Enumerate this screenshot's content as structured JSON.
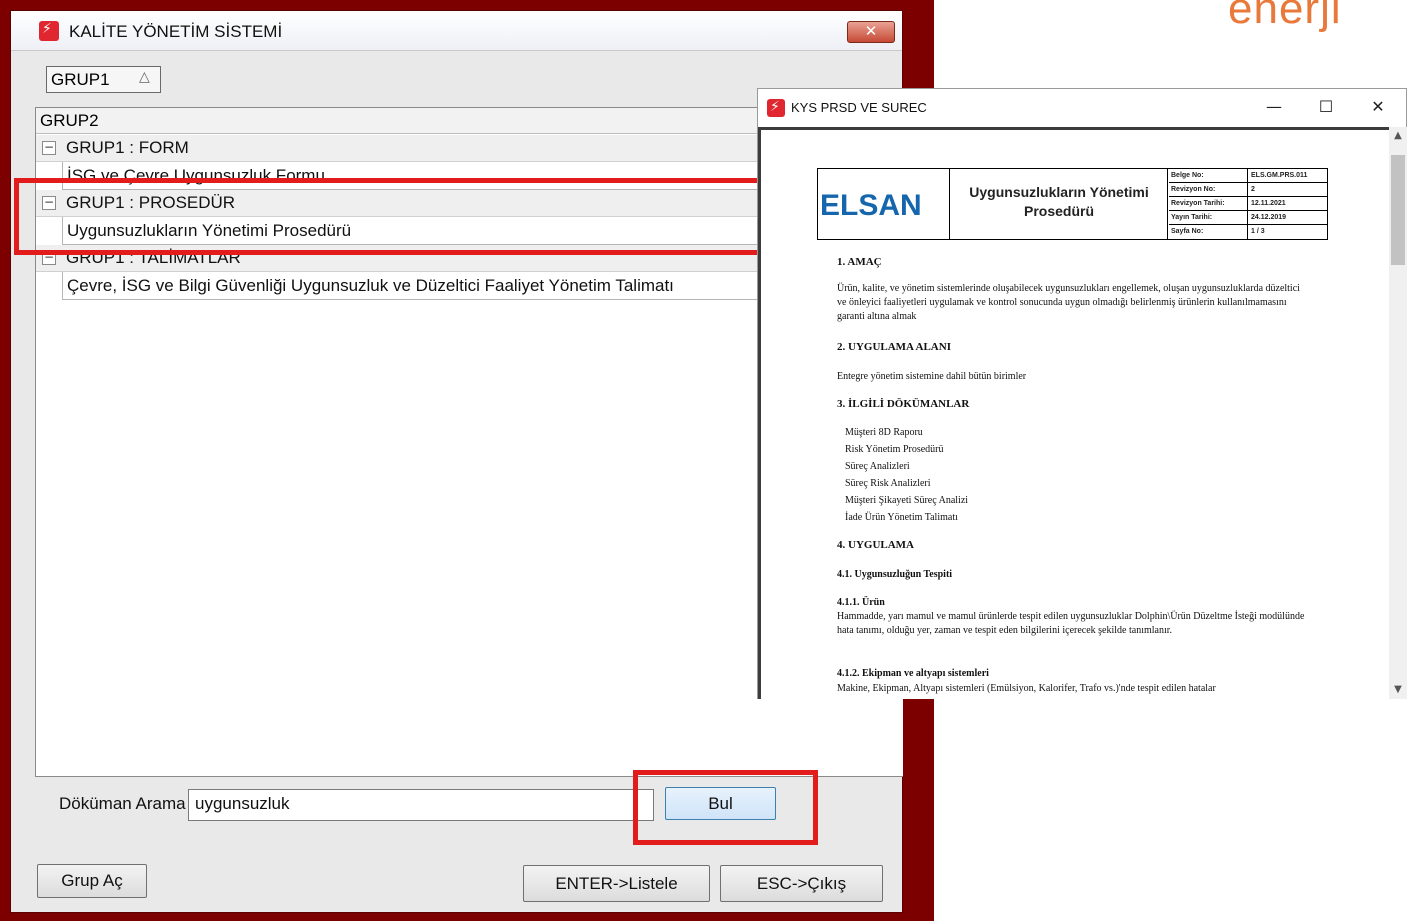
{
  "brand": {
    "text": "enerji"
  },
  "main_window": {
    "title": "KALİTE YÖNETİM SİSTEMİ",
    "close_label": "✕",
    "group_by_chip": "GRUP1",
    "group_by_sort_glyph": "△",
    "grid_header": "GRUP2",
    "groups": [
      {
        "label": "GRUP1 : FORM",
        "toggle": "−",
        "items": [
          "İSG ve Çevre Uygunsuzluk Formu"
        ]
      },
      {
        "label": "GRUP1 : PROSEDÜR",
        "toggle": "−",
        "items": [
          "Uygunsuzlukların Yönetimi Prosedürü"
        ]
      },
      {
        "label": "GRUP1 : TALİMATLAR",
        "toggle": "−",
        "items": [
          "Çevre, İSG ve Bilgi Güvenliği Uygunsuzluk ve Düzeltici Faaliyet Yönetim Talimatı"
        ]
      }
    ],
    "search": {
      "label": "Döküman Arama",
      "value": "uygunsuzluk"
    },
    "buttons": {
      "find": "Bul",
      "expand_group": "Grup Aç",
      "list": "ENTER->Listele",
      "exit": "ESC->Çıkış"
    }
  },
  "pdf_window": {
    "title": "KYS PRSD VE SUREC",
    "controls": {
      "minimize": "—",
      "maximize": "☐",
      "close": "✕"
    },
    "document": {
      "logo": "ELSAN",
      "title_line1": "Uygunsuzlukların Yönetimi",
      "title_line2": "Prosedürü",
      "meta": [
        {
          "key": "Belge No:",
          "value": "ELS.GM.PRS.011"
        },
        {
          "key": "Revizyon No:",
          "value": "2"
        },
        {
          "key": "Revizyon Tarihi:",
          "value": "12.11.2021"
        },
        {
          "key": "Yayın Tarihi:",
          "value": "24.12.2019"
        },
        {
          "key": "Sayfa No:",
          "value": "1 / 3"
        }
      ],
      "s1_heading": "1.  AMAÇ",
      "s1_text": "Ürün, kalite, ve yönetim sistemlerinde oluşabilecek uygunsuzlukları engellemek, oluşan uygunsuzluklarda düzeltici ve önleyici faaliyetleri uygulamak ve kontrol sonucunda uygun olmadığı belirlenmiş ürünlerin kullanılmamasını garanti altına almak",
      "s2_heading": "2.  UYGULAMA ALANI",
      "s2_text": "Entegre yönetim sistemine dahil bütün birimler",
      "s3_heading": "3.  İLGİLİ DÖKÜMANLAR",
      "s3_items": [
        "Müşteri 8D Raporu",
        "Risk Yönetim Prosedürü",
        "Süreç Analizleri",
        "Süreç Risk Analizleri",
        "Müşteri Şikayeti Süreç Analizi",
        "İade Ürün Yönetim Talimatı"
      ],
      "s4_heading": "4.  UYGULAMA",
      "s41_heading": "4.1. Uygunsuzluğun Tespiti",
      "s411_heading": "4.1.1. Ürün",
      "s411_text": "Hammadde, yarı mamul ve mamul ürünlerde tespit edilen uygunsuzluklar Dolphin\\Ürün Düzeltme İsteği modülünde hata tanımı, olduğu yer, zaman ve tespit eden bilgilerini içerecek şekilde tanımlanır.",
      "s412_heading": "4.1.2. Ekipman ve altyapı sistemleri",
      "s412_text": "Makine, Ekipman, Altyapı sistemleri (Emülsiyon, Kalorifer, Trafo vs.)'nde tespit edilen hatalar"
    }
  },
  "colors": {
    "frame": "#7d0000",
    "highlight": "#e21b1b",
    "brand": "#e8793a",
    "logo": "#1566ad"
  }
}
